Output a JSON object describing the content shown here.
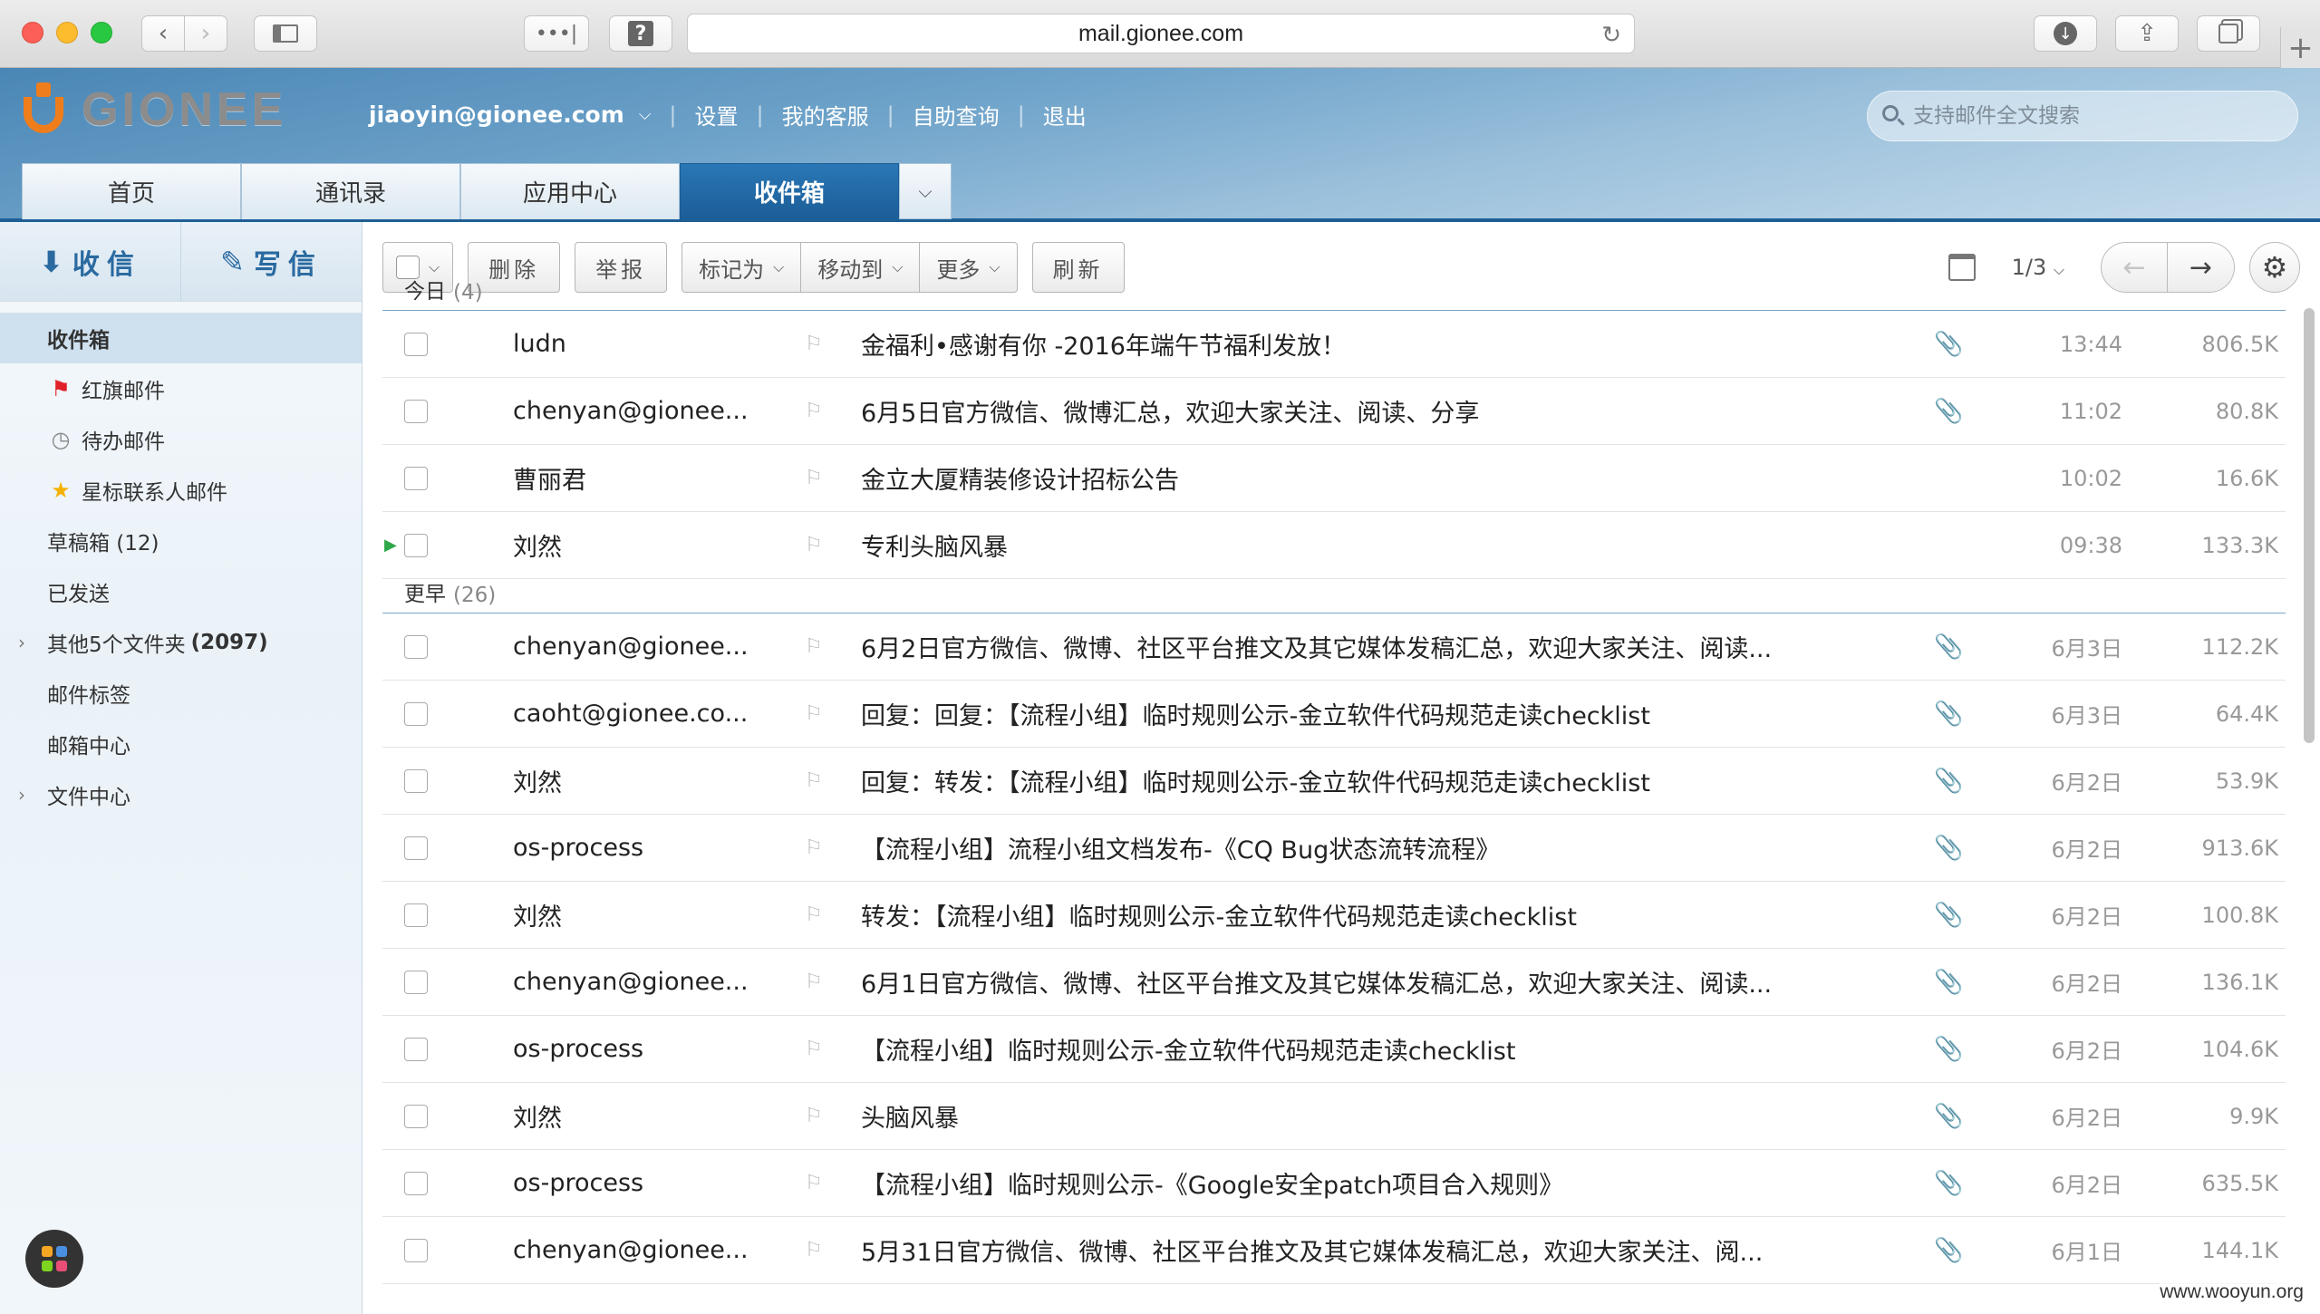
{
  "browser": {
    "url": "mail.gionee.com"
  },
  "header": {
    "logo_text": "GIONEE",
    "user_email": "jiaoyin@gionee.com",
    "links": [
      "设置",
      "我的客服",
      "自助查询",
      "退出"
    ],
    "search_placeholder": "支持邮件全文搜索"
  },
  "tabs": [
    {
      "label": "首页"
    },
    {
      "label": "通讯录"
    },
    {
      "label": "应用中心"
    },
    {
      "label": "收件箱",
      "active": true
    }
  ],
  "sidebar": {
    "receive_label": "收信",
    "compose_label": "写信",
    "folders": [
      {
        "label": "收件箱"
      },
      {
        "label": "红旗邮件"
      },
      {
        "label": "待办邮件"
      },
      {
        "label": "星标联系人邮件"
      },
      {
        "label": "草稿箱 (12)"
      },
      {
        "label": "已发送"
      },
      {
        "label": "其他5个文件夹",
        "count": "(2097)"
      },
      {
        "label": "邮件标签"
      },
      {
        "label": "邮箱中心"
      },
      {
        "label": "文件中心"
      }
    ]
  },
  "toolbar": {
    "delete": "删除",
    "report": "举报",
    "mark_as": "标记为",
    "move_to": "移动到",
    "more": "更多",
    "refresh": "刷新",
    "pager": "1/3"
  },
  "groups": [
    {
      "label": "今日",
      "count": "(4)",
      "mails": [
        {
          "sender": "ludn",
          "subject": "金福利•感谢有你 -2016年端午节福利发放！",
          "time": "13:44",
          "size": "806.5K",
          "attachment": true
        },
        {
          "sender": "chenyan@gionee...",
          "subject": "6月5日官方微信、微博汇总，欢迎大家关注、阅读、分享",
          "time": "11:02",
          "size": "80.8K",
          "attachment": true
        },
        {
          "sender": "曹丽君",
          "subject": "金立大厦精装修设计招标公告",
          "time": "10:02",
          "size": "16.6K",
          "attachment": false
        },
        {
          "sender": "刘然",
          "subject": "专利头脑风暴",
          "time": "09:38",
          "size": "133.3K",
          "attachment": false,
          "current": true
        }
      ]
    },
    {
      "label": "更早",
      "count": "(26)",
      "mails": [
        {
          "sender": "chenyan@gionee...",
          "subject": "6月2日官方微信、微博、社区平台推文及其它媒体发稿汇总，欢迎大家关注、阅读...",
          "time": "6月3日",
          "size": "112.2K",
          "attachment": true
        },
        {
          "sender": "caoht@gionee.co...",
          "subject": "回复：回复：【流程小组】临时规则公示-金立软件代码规范走读checklist",
          "time": "6月3日",
          "size": "64.4K",
          "attachment": true
        },
        {
          "sender": "刘然",
          "subject": "回复：转发：【流程小组】临时规则公示-金立软件代码规范走读checklist",
          "time": "6月2日",
          "size": "53.9K",
          "attachment": true
        },
        {
          "sender": "os-process",
          "subject": "【流程小组】流程小组文档发布-《CQ Bug状态流转流程》",
          "time": "6月2日",
          "size": "913.6K",
          "attachment": true
        },
        {
          "sender": "刘然",
          "subject": "转发：【流程小组】临时规则公示-金立软件代码规范走读checklist",
          "time": "6月2日",
          "size": "100.8K",
          "attachment": true
        },
        {
          "sender": "chenyan@gionee...",
          "subject": "6月1日官方微信、微博、社区平台推文及其它媒体发稿汇总，欢迎大家关注、阅读...",
          "time": "6月2日",
          "size": "136.1K",
          "attachment": true
        },
        {
          "sender": "os-process",
          "subject": "【流程小组】临时规则公示-金立软件代码规范走读checklist",
          "time": "6月2日",
          "size": "104.6K",
          "attachment": true
        },
        {
          "sender": "刘然",
          "subject": "头脑风暴",
          "time": "6月2日",
          "size": "9.9K",
          "attachment": true
        },
        {
          "sender": "os-process",
          "subject": "【流程小组】临时规则公示-《Google安全patch项目合入规则》",
          "time": "6月2日",
          "size": "635.5K",
          "attachment": true
        },
        {
          "sender": "chenyan@gionee...",
          "subject": "5月31日官方微信、微博、社区平台推文及其它媒体发稿汇总，欢迎大家关注、阅...",
          "time": "6月1日",
          "size": "144.1K",
          "attachment": true
        }
      ]
    }
  ],
  "watermark": "www.wooyun.org"
}
